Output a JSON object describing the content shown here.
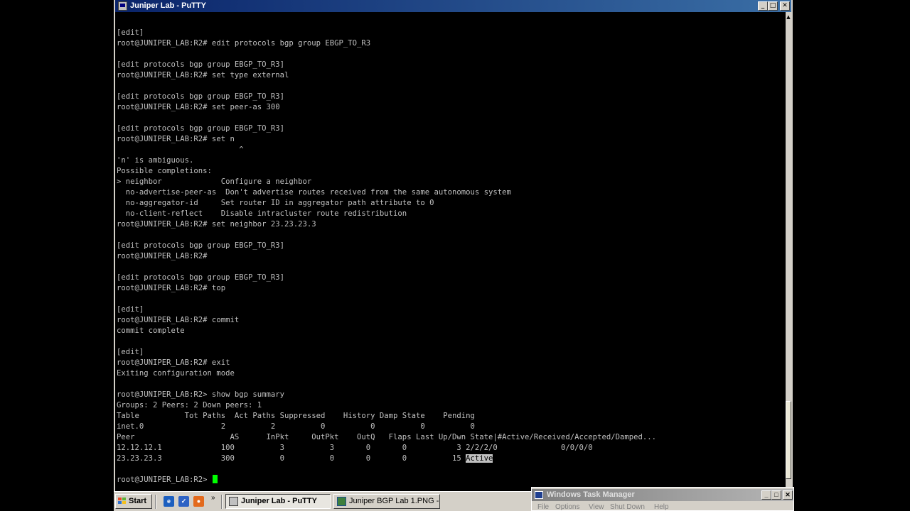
{
  "window": {
    "title": "Juniper Lab - PuTTY",
    "minimize_glyph": "_",
    "maximize_glyph": "□",
    "close_glyph": "✕"
  },
  "terminal": {
    "lines": [
      "[edit]",
      "root@JUNIPER_LAB:R2# edit protocols bgp group EBGP_TO_R3",
      "",
      "[edit protocols bgp group EBGP_TO_R3]",
      "root@JUNIPER_LAB:R2# set type external",
      "",
      "[edit protocols bgp group EBGP_TO_R3]",
      "root@JUNIPER_LAB:R2# set peer-as 300",
      "",
      "[edit protocols bgp group EBGP_TO_R3]",
      "root@JUNIPER_LAB:R2# set n",
      "                           ^",
      "'n' is ambiguous.",
      "Possible completions:",
      "> neighbor             Configure a neighbor",
      "  no-advertise-peer-as  Don't advertise routes received from the same autonomous system",
      "  no-aggregator-id     Set router ID in aggregator path attribute to 0",
      "  no-client-reflect    Disable intracluster route redistribution",
      "root@JUNIPER_LAB:R2# set neighbor 23.23.23.3",
      "",
      "[edit protocols bgp group EBGP_TO_R3]",
      "root@JUNIPER_LAB:R2#",
      "",
      "[edit protocols bgp group EBGP_TO_R3]",
      "root@JUNIPER_LAB:R2# top",
      "",
      "[edit]",
      "root@JUNIPER_LAB:R2# commit",
      "commit complete",
      "",
      "[edit]",
      "root@JUNIPER_LAB:R2# exit",
      "Exiting configuration mode",
      "",
      "root@JUNIPER_LAB:R2> show bgp summary",
      "Groups: 2 Peers: 2 Down peers: 1",
      "Table          Tot Paths  Act Paths Suppressed    History Damp State    Pending",
      "inet.0                 2          2          0          0          0          0",
      "Peer                     AS      InPkt     OutPkt    OutQ   Flaps Last Up/Dwn State|#Active/Received/Accepted/Damped...",
      "12.12.12.1             100          3          3       0       0           3 2/2/2/0              0/0/0/0",
      "23.23.23.3             300          0          0       0       0          15 "
    ],
    "highlighted_word": "Active",
    "prompt": "root@JUNIPER_LAB:R2> "
  },
  "taskbar": {
    "start_label": "Start",
    "quicklaunch": [
      {
        "icon": "ie-icon",
        "glyph": "e",
        "color": "#1c5fbf"
      },
      {
        "icon": "outlook-icon",
        "glyph": "✓",
        "color": "#2d62c4"
      },
      {
        "icon": "firefox-icon",
        "glyph": "●",
        "color": "#e36a1d"
      }
    ],
    "chevron": "»",
    "tasks": [
      {
        "label": "Juniper Lab - PuTTY",
        "active": true,
        "icon": "putty-icon"
      },
      {
        "label": "Juniper BGP Lab 1.PNG - ...",
        "active": false,
        "icon": "image-viewer-icon"
      }
    ]
  },
  "taskmgr": {
    "title": "Windows Task Manager",
    "menu": [
      "File",
      "Options",
      "View",
      "Shut Down",
      "Help"
    ],
    "minimize_glyph": "_",
    "maximize_glyph": "□",
    "close_glyph": "✕"
  }
}
